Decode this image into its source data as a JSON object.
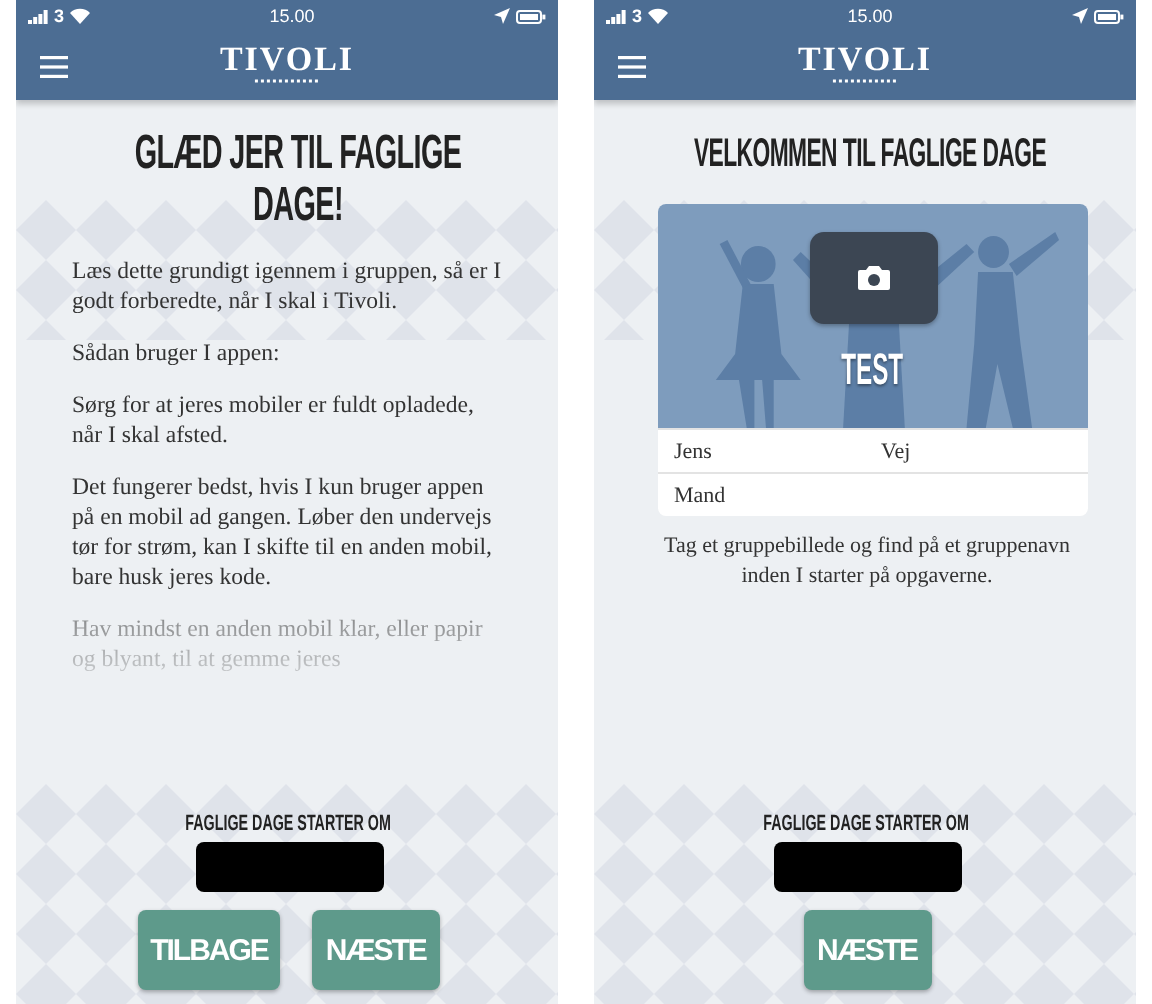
{
  "screens": [
    {
      "kind": "intro",
      "status": {
        "carrier": "3",
        "time": "15.00"
      },
      "logo": "TIVOLI",
      "heading": "GLÆD JER TIL FAGLIGE DAGE!",
      "paragraphs": [
        {
          "text": "Læs dette grundigt igennem i gruppen, så er I godt forberedte, når I skal i Tivoli.",
          "faded": false
        },
        {
          "text": "Sådan bruger I appen:",
          "faded": false
        },
        {
          "text": "Sørg for at jeres mobiler er fuldt opladede, når I skal afsted.",
          "faded": false
        },
        {
          "text": "Det fungerer bedst, hvis I kun bruger appen på en mobil ad gangen. Løber den undervejs tør for strøm, kan I skifte til en anden mobil, bare husk jeres kode.",
          "faded": false
        },
        {
          "text": "Hav mindst en anden mobil klar, eller papir og blyant, til at gemme jeres",
          "faded": true
        }
      ],
      "countdown_label": "FAGLIGE DAGE STARTER OM",
      "buttons": [
        "TILBAGE",
        "NÆSTE"
      ]
    },
    {
      "kind": "group",
      "status": {
        "carrier": "3",
        "time": "15.00"
      },
      "logo": "TIVOLI",
      "heading": "VELKOMMEN TIL FAGLIGE DAGE",
      "group": {
        "photo": {
          "kind": "picture"
        },
        "name": "TEST",
        "rows": [
          [
            "Jens",
            "Vej"
          ],
          [
            "Mand"
          ]
        ]
      },
      "note": "Tag et gruppebillede og find på et gruppenavn inden I starter på opgaverne.",
      "countdown_label": "FAGLIGE DAGE STARTER OM",
      "buttons": [
        "NÆSTE"
      ]
    }
  ]
}
